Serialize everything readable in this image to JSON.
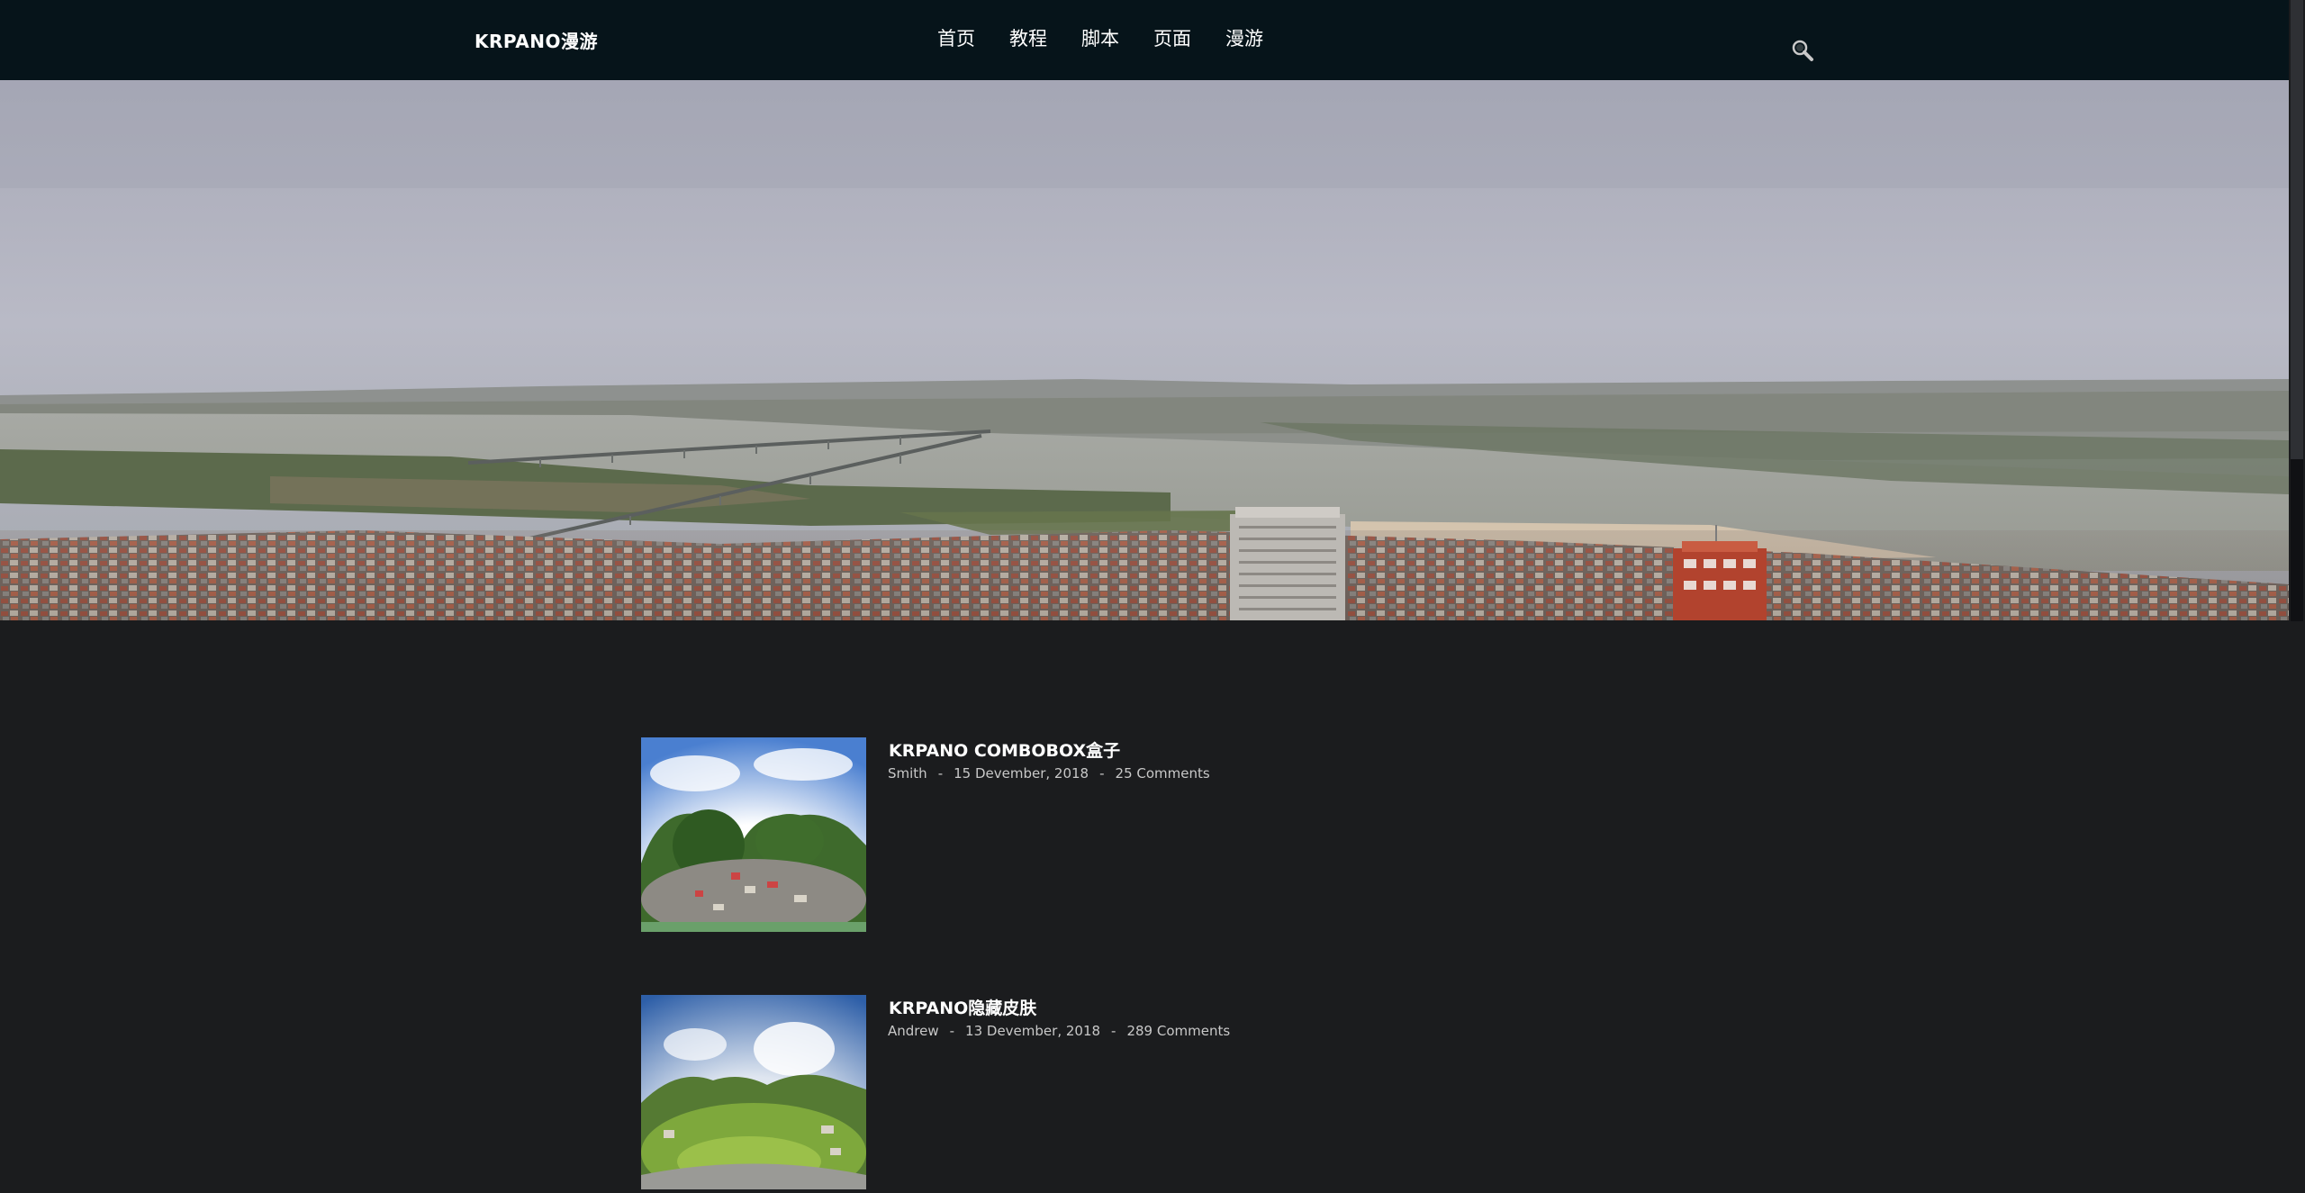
{
  "header": {
    "logo": "KRPANO漫游",
    "nav": [
      {
        "label": "首页"
      },
      {
        "label": "教程"
      },
      {
        "label": "脚本"
      },
      {
        "label": "页面"
      },
      {
        "label": "漫游"
      }
    ],
    "search_icon": "search-icon"
  },
  "posts": [
    {
      "title": "KRPANO COMBOBOX盒子",
      "author": "Smith",
      "date": "15 Devember, 2018",
      "comments": "25 Comments",
      "separator": "-"
    },
    {
      "title": "KRPANO隐藏皮肤",
      "author": "Andrew",
      "date": "13 Devember, 2018",
      "comments": "289 Comments",
      "separator": "-"
    }
  ],
  "colors": {
    "header_bg": "#06141a",
    "page_bg": "#1b1c1e",
    "text": "#ffffff",
    "meta_text": "#c8c8c8"
  }
}
